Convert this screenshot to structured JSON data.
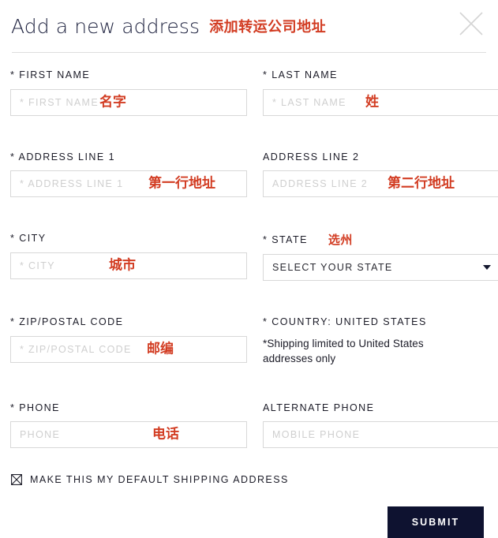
{
  "header": {
    "title": "Add a new address",
    "title_cn": "添加转运公司地址",
    "close_icon": "close-icon"
  },
  "colors": {
    "annotation_red": "#d23c22",
    "submit_bg": "#0e1230",
    "title": "#1f2340",
    "border": "#d8d8d8",
    "placeholder": "#cfcfcf"
  },
  "form": {
    "first_name": {
      "label": "* FIRST NAME",
      "placeholder": "* FIRST NAME",
      "value": "",
      "annotation": "名字"
    },
    "last_name": {
      "label": "* LAST NAME",
      "placeholder": "* LAST NAME",
      "value": "",
      "annotation": "姓"
    },
    "address_line_1": {
      "label": "* ADDRESS LINE 1",
      "placeholder": "* ADDRESS LINE 1",
      "value": "",
      "annotation": "第一行地址"
    },
    "address_line_2": {
      "label": "ADDRESS LINE 2",
      "placeholder": "ADDRESS LINE 2",
      "value": "",
      "annotation": "第二行地址"
    },
    "city": {
      "label": "* CITY",
      "placeholder": "* CITY",
      "value": "",
      "annotation": "城市"
    },
    "state": {
      "label": "* STATE",
      "label_annotation": "选州",
      "selected": "SELECT YOUR STATE",
      "caret_icon": "chevron-down-icon"
    },
    "zip": {
      "label": "* ZIP/POSTAL CODE",
      "placeholder": "* ZIP/POSTAL CODE",
      "value": "",
      "annotation": "邮编"
    },
    "country": {
      "label": "* COUNTRY: UNITED STATES",
      "note": "*Shipping limited to United States addresses only"
    },
    "phone": {
      "label": "* PHONE",
      "placeholder": "PHONE",
      "value": "",
      "annotation": "电话"
    },
    "alternate_phone": {
      "label": "ALTERNATE PHONE",
      "placeholder": "MOBILE PHONE",
      "value": ""
    },
    "default_address": {
      "label": "MAKE THIS MY DEFAULT SHIPPING ADDRESS",
      "checked": true,
      "icon": "checkbox-checked-icon"
    },
    "submit": {
      "label": "SUBMIT"
    }
  }
}
